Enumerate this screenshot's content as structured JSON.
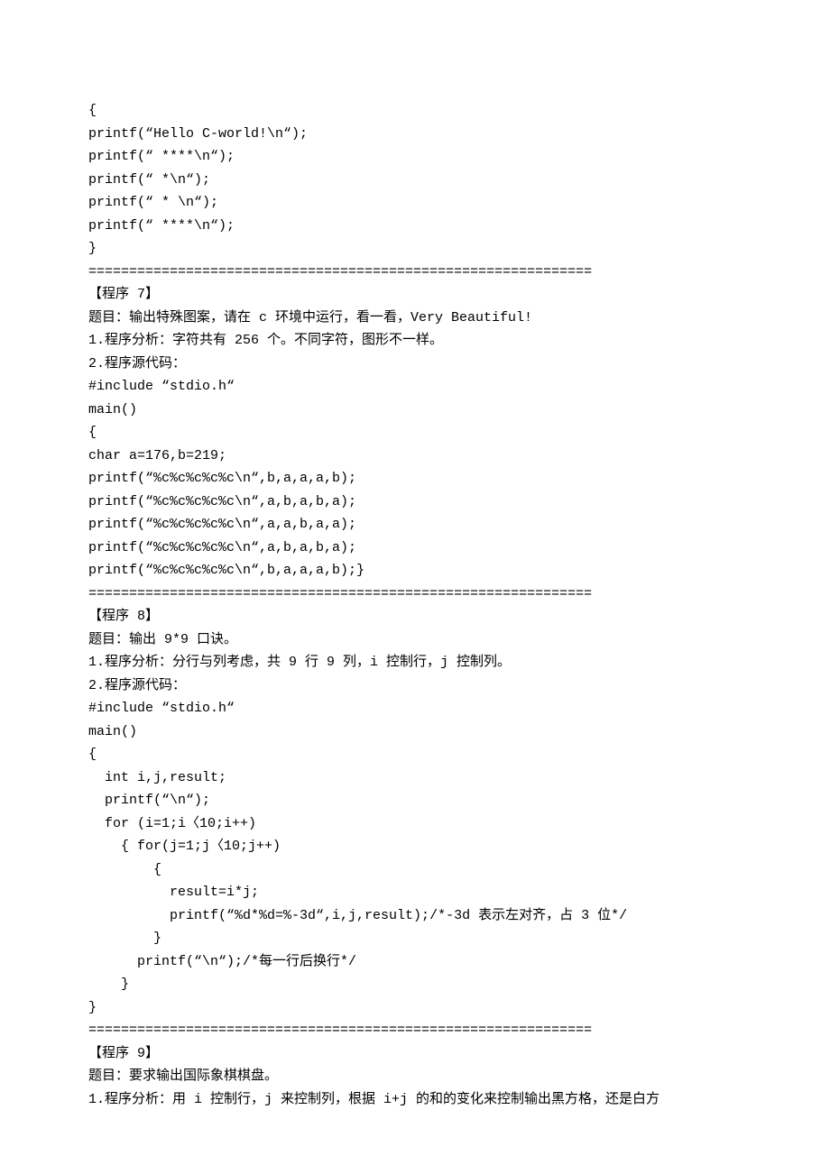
{
  "lines": [
    "{",
    "printf(“Hello C-world!\\n“);",
    "printf(“ ****\\n“);",
    "printf(“ *\\n“);",
    "printf(“ * \\n“);",
    "printf(“ ****\\n“);",
    "}",
    "==============================================================",
    "【程序 7】",
    "题目：输出特殊图案，请在 c 环境中运行，看一看，Very Beautiful!",
    "1.程序分析：字符共有 256 个。不同字符，图形不一样。",
    "2.程序源代码：",
    "#include “stdio.h“",
    "main()",
    "{",
    "char a=176,b=219;",
    "printf(“%c%c%c%c%c\\n“,b,a,a,a,b);",
    "printf(“%c%c%c%c%c\\n“,a,b,a,b,a);",
    "printf(“%c%c%c%c%c\\n“,a,a,b,a,a);",
    "printf(“%c%c%c%c%c\\n“,a,b,a,b,a);",
    "printf(“%c%c%c%c%c\\n“,b,a,a,a,b);}",
    "==============================================================",
    "【程序 8】",
    "题目：输出 9*9 口诀。",
    "1.程序分析：分行与列考虑，共 9 行 9 列，i 控制行，j 控制列。",
    "2.程序源代码：",
    "#include “stdio.h“",
    "main()",
    "{",
    "  int i,j,result;",
    "  printf(“\\n“);",
    "  for (i=1;i〈10;i++)",
    "    { for(j=1;j〈10;j++)",
    "        {",
    "          result=i*j;",
    "          printf(“%d*%d=%-3d“,i,j,result);/*-3d 表示左对齐，占 3 位*/",
    "        }",
    "      printf(“\\n“);/*每一行后换行*/",
    "    }",
    "}",
    "==============================================================",
    "【程序 9】",
    "题目：要求输出国际象棋棋盘。",
    "1.程序分析：用 i 控制行，j 来控制列，根据 i+j 的和的变化来控制输出黑方格，还是白方"
  ]
}
